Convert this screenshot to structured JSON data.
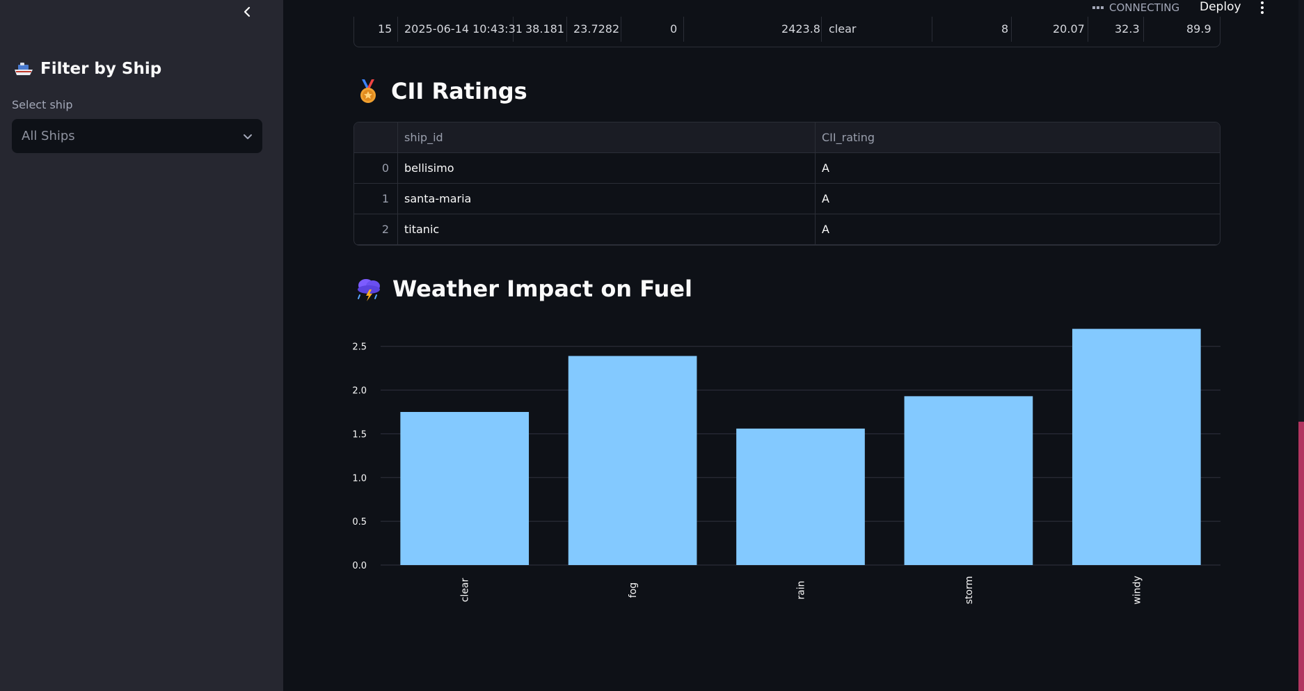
{
  "sidebar": {
    "title": "Filter by Ship",
    "select_label": "Select ship",
    "select_value": "All Ships"
  },
  "header": {
    "status": "CONNECTING",
    "deploy": "Deploy"
  },
  "top_table": {
    "row": {
      "index": "15",
      "timestamp": "2025-06-14 10:43:31",
      "c2": "38.181",
      "c3": "23.7282",
      "c4": "0",
      "c5": "2423.8",
      "weather": "clear",
      "c7": "8",
      "c8": "20.07",
      "c9": "32.3",
      "c10": "89.9"
    }
  },
  "cii": {
    "heading": "CII Ratings",
    "columns": [
      "ship_id",
      "CII_rating"
    ],
    "rows": [
      {
        "index": "0",
        "ship_id": "bellisimo",
        "rating": "A"
      },
      {
        "index": "1",
        "ship_id": "santa-maria",
        "rating": "A"
      },
      {
        "index": "2",
        "ship_id": "titanic",
        "rating": "A"
      }
    ]
  },
  "weather": {
    "heading": "Weather Impact on Fuel"
  },
  "chart_data": {
    "type": "bar",
    "categories": [
      "clear",
      "fog",
      "rain",
      "storm",
      "windy"
    ],
    "values": [
      1.75,
      2.39,
      1.56,
      1.93,
      2.7
    ],
    "yticks": [
      "0.0",
      "0.5",
      "1.0",
      "1.5",
      "2.0",
      "2.5"
    ],
    "ylim": [
      0,
      2.8
    ],
    "grid": true,
    "bar_color": "#83c9ff"
  },
  "colors": {
    "background": "#0e1117",
    "sidebar": "#262730",
    "bar": "#83c9ff"
  },
  "icons": {
    "sidebar_title": "ship-icon",
    "cii": "medal-icon",
    "weather": "storm-cloud-icon"
  }
}
